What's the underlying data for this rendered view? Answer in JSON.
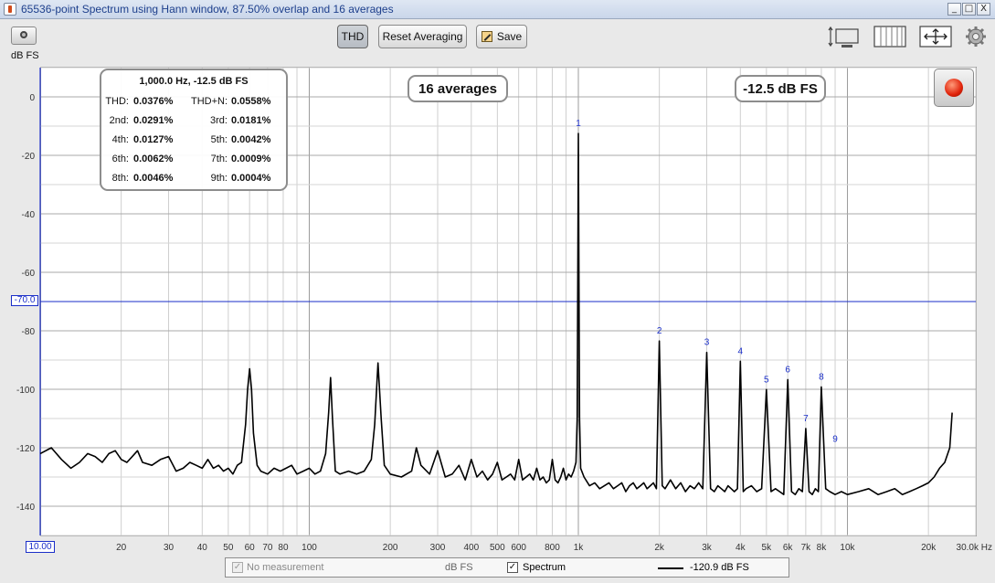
{
  "window": {
    "title": "65536-point Spectrum using Hann window, 87.50% overlap and 16 averages",
    "controls": [
      "_",
      "□",
      "X"
    ]
  },
  "toolbar": {
    "unit_label": "dB FS",
    "thd_label": "THD",
    "reset_label": "Reset Averaging",
    "save_label": "Save",
    "icons": [
      "camera-icon",
      "fit-vertical-icon",
      "grid-lines-icon",
      "pan-zoom-icon",
      "gear-icon"
    ]
  },
  "info": {
    "header": "1,000.0 Hz, -12.5 dB FS",
    "rows": [
      {
        "l1": "THD:",
        "v1": "0.0376%",
        "l2": "THD+N:",
        "v2": "0.0558%"
      },
      {
        "l1": "2nd:",
        "v1": "0.0291%",
        "l2": "3rd:",
        "v2": "0.0181%"
      },
      {
        "l1": "4th:",
        "v1": "0.0127%",
        "l2": "5th:",
        "v2": "0.0042%"
      },
      {
        "l1": "6th:",
        "v1": "0.0062%",
        "l2": "7th:",
        "v2": "0.0009%"
      },
      {
        "l1": "8th:",
        "v1": "0.0046%",
        "l2": "9th:",
        "v2": "0.0004%"
      }
    ]
  },
  "averages_label": "16 averages",
  "level_label": "-12.5 dB FS",
  "reference_label": "-70.0",
  "x_start_label": "10.00",
  "legend": {
    "no_measurement": "No measurement",
    "unit": "dB FS",
    "spectrum": "Spectrum",
    "value": "-120.9 dB FS"
  },
  "chart_data": {
    "type": "line",
    "title": "",
    "xlabel": "",
    "ylabel": "dB FS",
    "x_scale": "log",
    "xlim": [
      10,
      30000
    ],
    "ylim": [
      -150,
      10
    ],
    "y_ticks": [
      0,
      -20,
      -40,
      -60,
      -80,
      -100,
      -120,
      -140
    ],
    "x_tick_labels": [
      {
        "v": 20,
        "t": "20"
      },
      {
        "v": 30,
        "t": "30"
      },
      {
        "v": 40,
        "t": "40"
      },
      {
        "v": 50,
        "t": "50"
      },
      {
        "v": 60,
        "t": "60"
      },
      {
        "v": 70,
        "t": "70"
      },
      {
        "v": 80,
        "t": "80"
      },
      {
        "v": 100,
        "t": "100"
      },
      {
        "v": 200,
        "t": "200"
      },
      {
        "v": 300,
        "t": "300"
      },
      {
        "v": 400,
        "t": "400"
      },
      {
        "v": 500,
        "t": "500"
      },
      {
        "v": 600,
        "t": "600"
      },
      {
        "v": 800,
        "t": "800"
      },
      {
        "v": 1000,
        "t": "1k"
      },
      {
        "v": 2000,
        "t": "2k"
      },
      {
        "v": 3000,
        "t": "3k"
      },
      {
        "v": 4000,
        "t": "4k"
      },
      {
        "v": 5000,
        "t": "5k"
      },
      {
        "v": 6000,
        "t": "6k"
      },
      {
        "v": 7000,
        "t": "7k"
      },
      {
        "v": 8000,
        "t": "8k"
      },
      {
        "v": 10000,
        "t": "10k"
      },
      {
        "v": 20000,
        "t": "20k"
      },
      {
        "v": 30000,
        "t": "30.0k Hz"
      }
    ],
    "reference_line": -70,
    "grid": true,
    "harmonics": [
      {
        "label": "1",
        "x": 1000,
        "y": -12.5
      },
      {
        "label": "2",
        "x": 2000,
        "y": -83.5
      },
      {
        "label": "3",
        "x": 3000,
        "y": -87.4
      },
      {
        "label": "4",
        "x": 4000,
        "y": -90.4
      },
      {
        "label": "5",
        "x": 5000,
        "y": -100.1
      },
      {
        "label": "6",
        "x": 6000,
        "y": -96.7
      },
      {
        "label": "7",
        "x": 7000,
        "y": -113.4
      },
      {
        "label": "8",
        "x": 8000,
        "y": -99.2
      },
      {
        "label": "9",
        "x": 9000,
        "y": -120.5
      }
    ],
    "series": [
      {
        "name": "Spectrum",
        "x": [
          10,
          11,
          12,
          13,
          14,
          15,
          16,
          17,
          18,
          19,
          20,
          21,
          22,
          23,
          24,
          26,
          28,
          30,
          32,
          34,
          36,
          38,
          40,
          42,
          44,
          46,
          48,
          50,
          52,
          54,
          56,
          58,
          59,
          60,
          61,
          62,
          64,
          66,
          70,
          74,
          78,
          82,
          86,
          90,
          95,
          100,
          105,
          110,
          115,
          118,
          120,
          122,
          125,
          130,
          140,
          150,
          160,
          170,
          175,
          180,
          185,
          190,
          200,
          220,
          240,
          250,
          260,
          280,
          300,
          320,
          340,
          360,
          380,
          400,
          420,
          440,
          460,
          480,
          500,
          520,
          540,
          560,
          580,
          600,
          620,
          640,
          660,
          680,
          700,
          720,
          740,
          760,
          780,
          800,
          820,
          840,
          860,
          880,
          900,
          920,
          940,
          960,
          980,
          990,
          995,
          1000,
          1005,
          1010,
          1020,
          1050,
          1100,
          1150,
          1200,
          1250,
          1300,
          1350,
          1400,
          1450,
          1500,
          1550,
          1600,
          1650,
          1700,
          1750,
          1800,
          1850,
          1900,
          1950,
          2000,
          2050,
          2100,
          2200,
          2300,
          2400,
          2500,
          2600,
          2700,
          2800,
          2900,
          3000,
          3100,
          3200,
          3300,
          3400,
          3500,
          3600,
          3700,
          3800,
          3900,
          4000,
          4100,
          4200,
          4400,
          4600,
          4800,
          5000,
          5200,
          5400,
          5600,
          5800,
          6000,
          6200,
          6400,
          6600,
          6800,
          7000,
          7200,
          7400,
          7600,
          7800,
          8000,
          8300,
          8600,
          9000,
          9500,
          10000,
          11000,
          12000,
          13000,
          14000,
          15000,
          16000,
          17000,
          18000,
          19000,
          20000,
          21000,
          22000,
          23000,
          24000,
          24500
        ],
        "y": [
          -122,
          -120,
          -124,
          -127,
          -125,
          -122,
          -123,
          -125,
          -122,
          -121,
          -124,
          -125,
          -123,
          -121,
          -125,
          -126,
          -124,
          -123,
          -128,
          -127,
          -125,
          -126,
          -127,
          -124,
          -127,
          -126,
          -128,
          -127,
          -129,
          -126,
          -125,
          -112,
          -100,
          -93,
          -100,
          -115,
          -126,
          -128,
          -129,
          -127,
          -128,
          -127,
          -126,
          -129,
          -128,
          -127,
          -129,
          -128,
          -122,
          -108,
          -96,
          -110,
          -128,
          -129,
          -128,
          -129,
          -128,
          -124,
          -112,
          -91,
          -110,
          -126,
          -129,
          -130,
          -128,
          -120,
          -126,
          -129,
          -121,
          -130,
          -129,
          -126,
          -131,
          -124,
          -130,
          -128,
          -131,
          -129,
          -125,
          -131,
          -130,
          -129,
          -131,
          -124,
          -131,
          -130,
          -129,
          -131,
          -127,
          -131,
          -130,
          -132,
          -131,
          -124,
          -131,
          -132,
          -130,
          -127,
          -131,
          -129,
          -130,
          -128,
          -125,
          -110,
          -60,
          -12.5,
          -60,
          -110,
          -127,
          -130,
          -133,
          -132,
          -134,
          -133,
          -132,
          -134,
          -133,
          -132,
          -135,
          -133,
          -132,
          -134,
          -133,
          -132,
          -134,
          -133,
          -132,
          -134,
          -83.5,
          -133,
          -134,
          -131,
          -134,
          -132,
          -135,
          -133,
          -134,
          -132,
          -134,
          -87.4,
          -134,
          -135,
          -133,
          -134,
          -135,
          -133,
          -134,
          -135,
          -134,
          -90.4,
          -135,
          -134,
          -133,
          -135,
          -134,
          -100.1,
          -135,
          -134,
          -135,
          -136,
          -96.7,
          -135,
          -136,
          -134,
          -135,
          -113.4,
          -135,
          -136,
          -134,
          -135,
          -99.2,
          -134,
          -135,
          -136,
          -135,
          -136,
          -135,
          -134,
          -136,
          -135,
          -134,
          -136,
          -135,
          -134,
          -133,
          -132,
          -130,
          -127,
          -125,
          -120,
          -108
        ]
      }
    ]
  }
}
